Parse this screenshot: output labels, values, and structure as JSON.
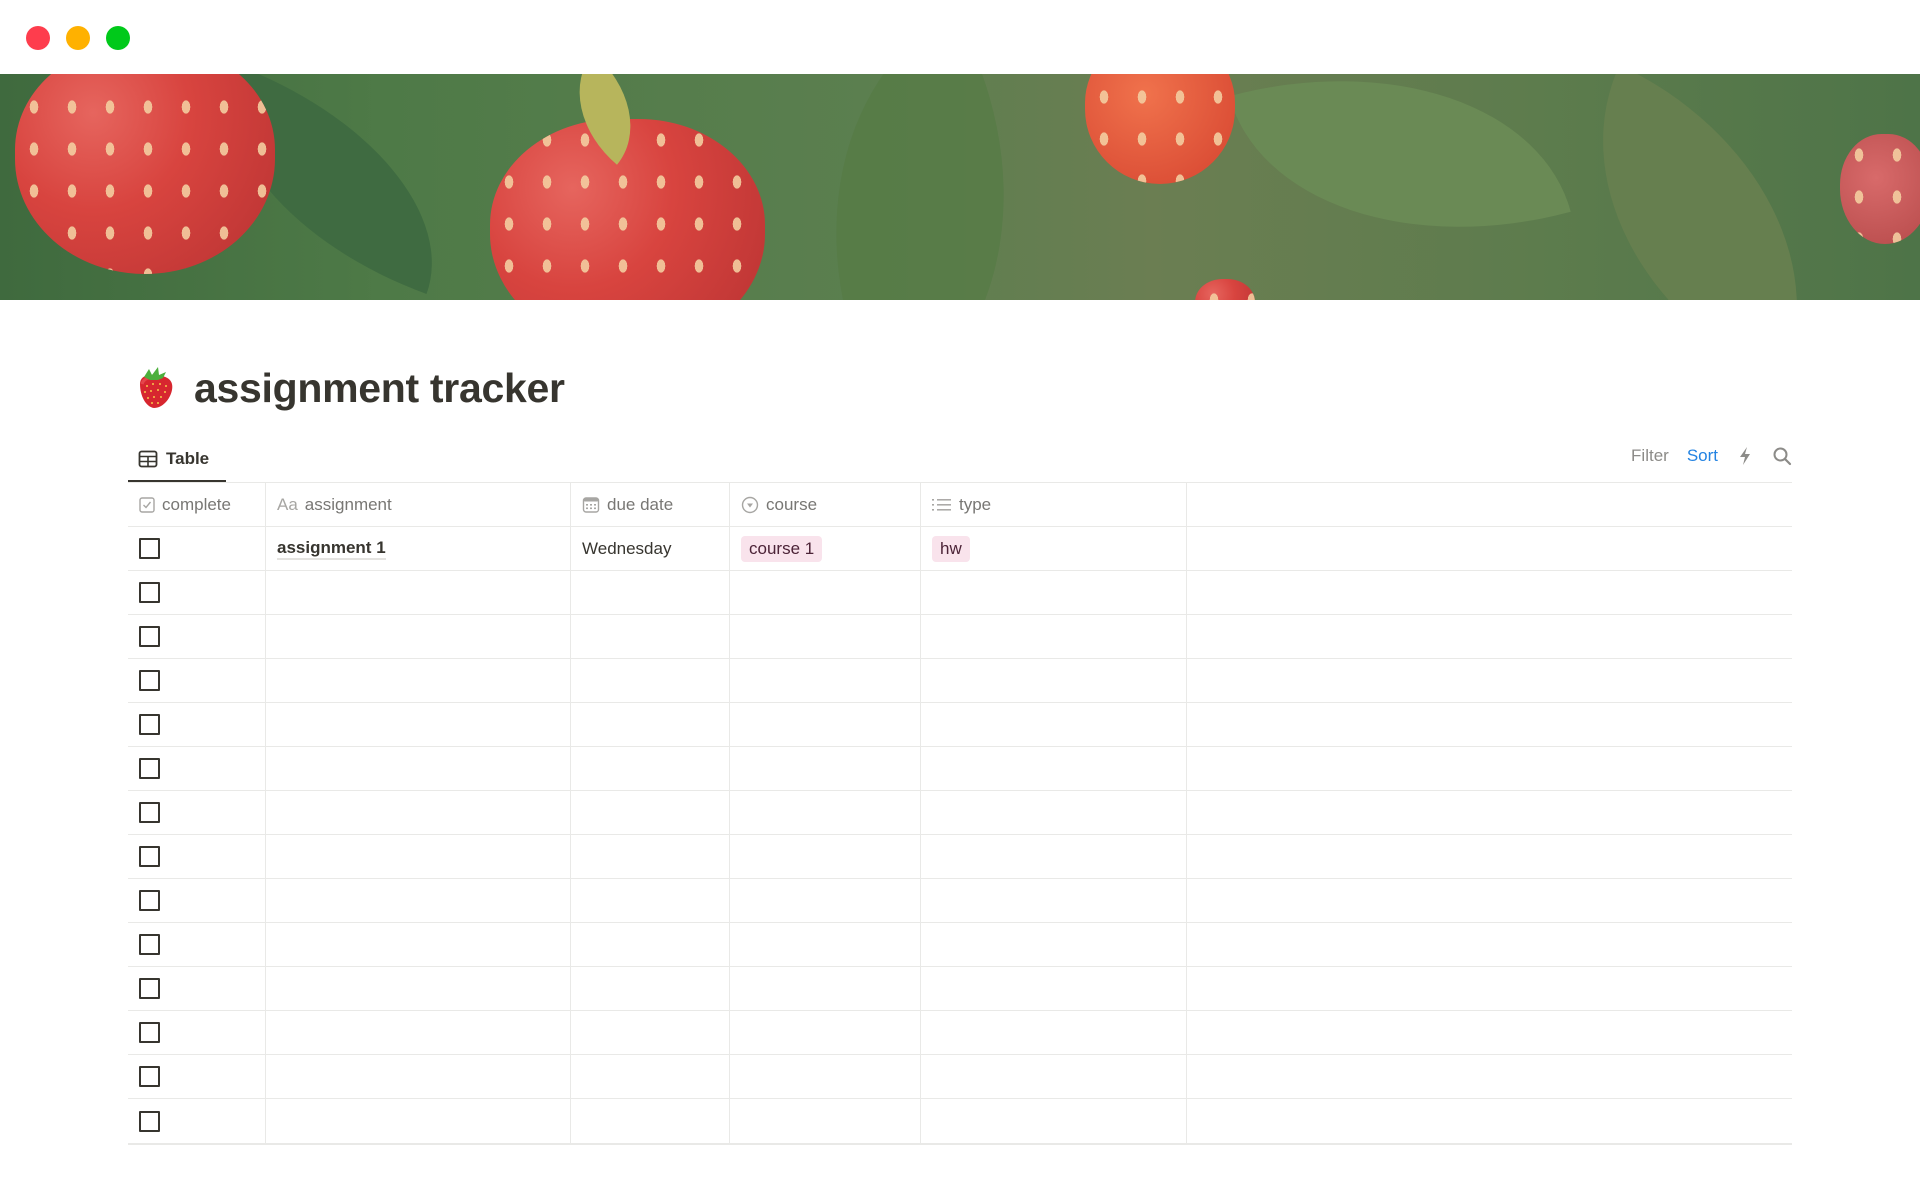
{
  "window": {
    "controls": [
      "close",
      "minimize",
      "maximize"
    ]
  },
  "banner": {
    "description": "painted raspberries and leaves cover image"
  },
  "page": {
    "icon": "strawberry-emoji",
    "title": "assignment tracker"
  },
  "view": {
    "tab_label": "Table",
    "filter_label": "Filter",
    "sort_label": "Sort",
    "automation_icon": "lightning-icon",
    "search_icon": "search-icon"
  },
  "table": {
    "columns": [
      {
        "label": "complete",
        "icon": "checkbox-icon"
      },
      {
        "label": "assignment",
        "icon": "Aa"
      },
      {
        "label": "due date",
        "icon": "calendar-icon"
      },
      {
        "label": "course",
        "icon": "select-icon"
      },
      {
        "label": "type",
        "icon": "list-icon"
      }
    ],
    "rows": [
      {
        "complete": false,
        "assignment": "assignment 1",
        "due_date": "Wednesday",
        "course": "course 1",
        "type": "hw"
      },
      {
        "complete": false,
        "assignment": "",
        "due_date": "",
        "course": "",
        "type": ""
      },
      {
        "complete": false,
        "assignment": "",
        "due_date": "",
        "course": "",
        "type": ""
      },
      {
        "complete": false,
        "assignment": "",
        "due_date": "",
        "course": "",
        "type": ""
      },
      {
        "complete": false,
        "assignment": "",
        "due_date": "",
        "course": "",
        "type": ""
      },
      {
        "complete": false,
        "assignment": "",
        "due_date": "",
        "course": "",
        "type": ""
      },
      {
        "complete": false,
        "assignment": "",
        "due_date": "",
        "course": "",
        "type": ""
      },
      {
        "complete": false,
        "assignment": "",
        "due_date": "",
        "course": "",
        "type": ""
      },
      {
        "complete": false,
        "assignment": "",
        "due_date": "",
        "course": "",
        "type": ""
      },
      {
        "complete": false,
        "assignment": "",
        "due_date": "",
        "course": "",
        "type": ""
      },
      {
        "complete": false,
        "assignment": "",
        "due_date": "",
        "course": "",
        "type": ""
      },
      {
        "complete": false,
        "assignment": "",
        "due_date": "",
        "course": "",
        "type": ""
      },
      {
        "complete": false,
        "assignment": "",
        "due_date": "",
        "course": "",
        "type": ""
      },
      {
        "complete": false,
        "assignment": "",
        "due_date": "",
        "course": "",
        "type": ""
      }
    ]
  },
  "colors": {
    "tag_background": "#f9e3ec",
    "tag_text": "#4c2337",
    "sort_accent": "#2383e2",
    "close": "#fe3d4d",
    "minimize": "#ffb100",
    "maximize": "#00c91a"
  }
}
